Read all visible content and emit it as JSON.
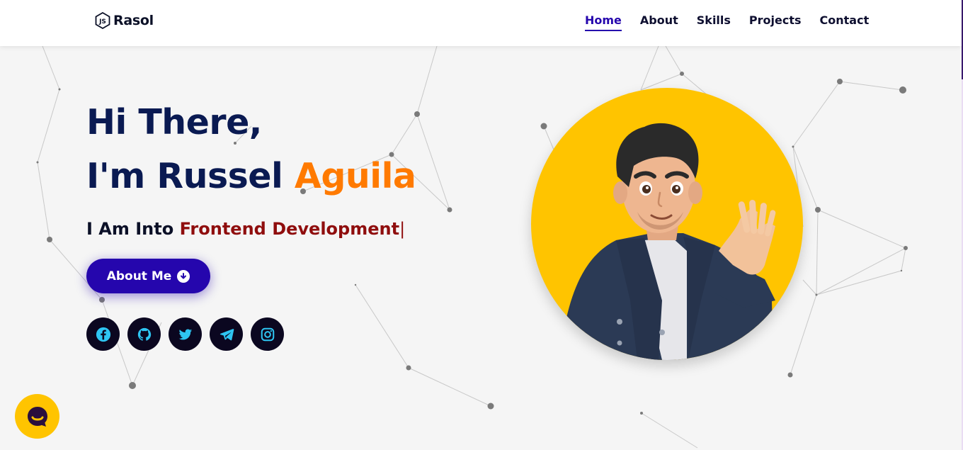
{
  "brand": {
    "name": "Rasol",
    "icon": "nodejs-logo-icon"
  },
  "nav": {
    "items": [
      {
        "label": "Home",
        "active": true
      },
      {
        "label": "About",
        "active": false
      },
      {
        "label": "Skills",
        "active": false
      },
      {
        "label": "Projects",
        "active": false
      },
      {
        "label": "Contact",
        "active": false
      }
    ]
  },
  "hero": {
    "greeting": "Hi There,",
    "intro_prefix": "I'm Russel ",
    "intro_accent": "Aguila",
    "into_prefix": "I Am Into ",
    "into_typed": "Frontend Development",
    "cursor": "|",
    "about_button": "About Me",
    "about_button_icon": "arrow-down-circle-icon"
  },
  "socials": [
    {
      "name": "facebook",
      "icon": "facebook-icon"
    },
    {
      "name": "github",
      "icon": "github-icon"
    },
    {
      "name": "twitter",
      "icon": "twitter-icon"
    },
    {
      "name": "telegram",
      "icon": "telegram-icon"
    },
    {
      "name": "instagram",
      "icon": "instagram-icon"
    }
  ],
  "avatar": {
    "description": "3D cartoon man waving",
    "icon": "avatar-illustration"
  },
  "chat": {
    "icon": "chat-bubble-icon"
  },
  "colors": {
    "primary": "#2506ad",
    "navy": "#0a1a52",
    "accent_orange": "#ff7a00",
    "typed_red": "#8f0d0d",
    "avatar_bg": "#ffc400",
    "social_bg": "#0b0720",
    "social_icon": "#2ec5f2",
    "background": "#f5f5f5"
  }
}
